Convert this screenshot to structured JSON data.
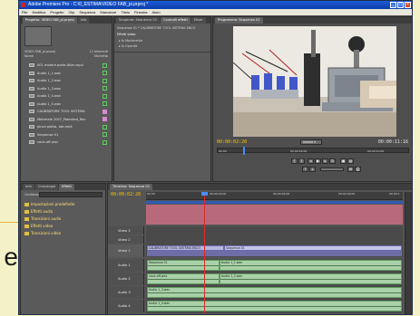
{
  "window": {
    "title": "Adobe Premiere Pro - C:\\0_ESTIMA\\VIDEO FAB_pi.prproj *"
  },
  "menu": [
    "File",
    "Modifica",
    "Progetto",
    "Clip",
    "Sequenza",
    "Marcatore",
    "Titolo",
    "Finestra",
    "Aiuto"
  ],
  "project_panel": {
    "tabs": [
      "Progetto: VIDEO FAB_pi.prproj",
      "Info"
    ],
    "project_name": "VIDEO FAB_pi.prproj",
    "item_count": "11 elementi",
    "col_name": "Nome",
    "col_label": "Etichetta",
    "files": [
      "001 motore porta Allen.mp4",
      "Audio 1_1.wav",
      "Audio 1_2.wav",
      "Audio 1_3.wav",
      "Audio 1_4.wav",
      "Audio 1_5.wav",
      "CALIBRATORE TOOL SISTEMA",
      "Materiale 2007_Patented_Rev",
      "pinza piatta. tab.mp4",
      "Sequenza 01",
      "voce-off.wav"
    ]
  },
  "source_panel": {
    "tabs": [
      "Sorgente: Sequenza 01",
      "Controlli effetti",
      "Mixer"
    ],
    "clip_name": "Sequenza 01 * CALIBRATORE TOOL SISTEMA ENCO",
    "section": "Effetti video",
    "effects": [
      "Movimento",
      "Opacità"
    ]
  },
  "program_monitor": {
    "tab": "Programma: Sequenza 01",
    "timecode_current": "00:00:02:20",
    "fit_label": "Adatta",
    "timecode_total": "00:00:11:16",
    "ruler": [
      "00:00",
      "00:00:05:00",
      "00:00:10:00"
    ]
  },
  "effects_panel": {
    "tabs": [
      "Info",
      "Cronologia",
      "Effetti"
    ],
    "search_label": "Contiene:",
    "bins": [
      "Impostazioni predefinite",
      "Effetti audio",
      "Transizioni audio",
      "Effetti video",
      "Transizioni video"
    ]
  },
  "timeline": {
    "tab": "Timeline: Sequenza 01",
    "timecode": "00:00:02:20",
    "ruler": [
      "00:00",
      "00:00:03:00",
      "00:00:06:00",
      "00:00:09:00",
      "00:00:1"
    ],
    "video_tracks": [
      "Video 3",
      "Video 2",
      "Video 1"
    ],
    "audio_tracks": [
      "Audio 1",
      "Audio 2",
      "Audio 3",
      "Audio 4"
    ],
    "clips": {
      "video1_a": "CALIBRATORE TOOL SISTEMA ENCO",
      "video1_b": "Sequenza 01",
      "audio1_a": "Sequenza 01",
      "audio1_b": "Audio 1_1.wav",
      "audio2_a": "voce-off.wav",
      "audio2_b": "Audio 1_2.wav",
      "audio3_a": "Audio 1_3.wav",
      "audio4_a": "Audio 1_4.wav"
    }
  }
}
